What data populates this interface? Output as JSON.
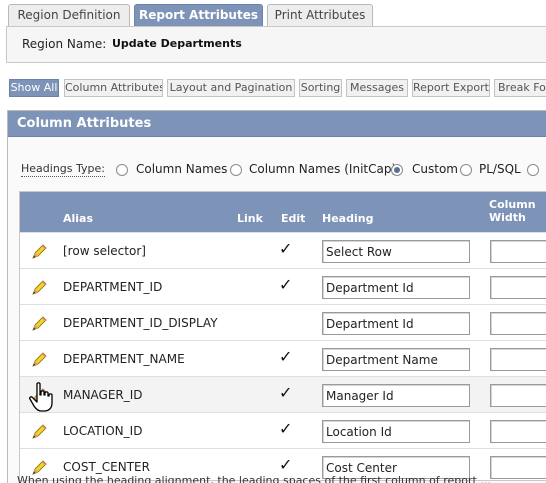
{
  "top_tabs": [
    {
      "label": "Region Definition",
      "active": false
    },
    {
      "label": "Report Attributes",
      "active": true
    },
    {
      "label": "Print Attributes",
      "active": false
    }
  ],
  "region": {
    "label": "Region Name:",
    "value": "Update Departments"
  },
  "subnav": [
    {
      "label": "Show All",
      "active": true
    },
    {
      "label": "Column Attributes",
      "active": false
    },
    {
      "label": "Layout and Pagination",
      "active": false
    },
    {
      "label": "Sorting",
      "active": false
    },
    {
      "label": "Messages",
      "active": false
    },
    {
      "label": "Report Export",
      "active": false
    },
    {
      "label": "Break Formatting",
      "active": false
    }
  ],
  "panel": {
    "title": "Column Attributes",
    "headings_type": {
      "label": "Headings Type:",
      "options": [
        {
          "label": "Column Names",
          "checked": false
        },
        {
          "label": "Column Names (InitCap)",
          "checked": false
        },
        {
          "label": "Custom",
          "checked": true
        },
        {
          "label": "PL/SQL",
          "checked": false
        },
        {
          "label": "",
          "checked": false
        }
      ]
    }
  },
  "table": {
    "headers": {
      "alias": "Alias",
      "link": "Link",
      "edit": "Edit",
      "heading": "Heading",
      "column_width": "Column Width"
    },
    "rows": [
      {
        "alias": "[row selector]",
        "edit": true,
        "heading": "Select Row",
        "width": ""
      },
      {
        "alias": "DEPARTMENT_ID",
        "edit": true,
        "heading": "Department Id",
        "width": ""
      },
      {
        "alias": "DEPARTMENT_ID_DISPLAY",
        "edit": false,
        "heading": "Department Id",
        "width": ""
      },
      {
        "alias": "DEPARTMENT_NAME",
        "edit": true,
        "heading": "Department Name",
        "width": ""
      },
      {
        "alias": "MANAGER_ID",
        "edit": true,
        "heading": "Manager Id",
        "width": ""
      },
      {
        "alias": "LOCATION_ID",
        "edit": true,
        "heading": "Location Id",
        "width": ""
      },
      {
        "alias": "COST_CENTER",
        "edit": true,
        "heading": "Cost Center",
        "width": ""
      }
    ],
    "edit_icon": "pencil-icon",
    "check_glyph": "✓"
  },
  "footnote": "When using the heading alignment, the leading spaces of the first column of report ...",
  "colors": {
    "accent": "#7d93b8",
    "accent_border": "#6c83a9"
  }
}
